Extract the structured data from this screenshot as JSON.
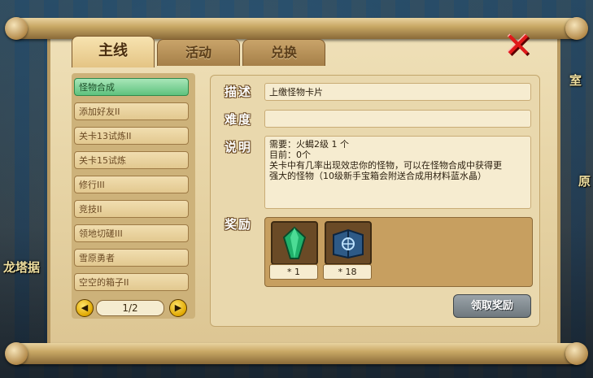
{
  "background": {
    "label_left": "龙塔据",
    "label_right_top": "室",
    "label_right_mid": "原"
  },
  "tabs": [
    {
      "label": "主线",
      "active": true
    },
    {
      "label": "活动",
      "active": false
    },
    {
      "label": "兑换",
      "active": false
    }
  ],
  "close_symbol": "✕",
  "quest_list": {
    "items": [
      {
        "label": "怪物合成",
        "active": true
      },
      {
        "label": "添加好友II",
        "active": false
      },
      {
        "label": "关卡13试炼II",
        "active": false
      },
      {
        "label": "关卡15试炼",
        "active": false
      },
      {
        "label": "修行III",
        "active": false
      },
      {
        "label": "竞技II",
        "active": false
      },
      {
        "label": "领地切磋III",
        "active": false
      },
      {
        "label": "雪原勇者",
        "active": false
      },
      {
        "label": "空空的箱子II",
        "active": false
      }
    ],
    "page_indicator": "1/2",
    "prev_arrow": "◀",
    "next_arrow": "▶"
  },
  "detail": {
    "desc_label": "描述",
    "desc_value": "上缴怪物卡片",
    "difficulty_label": "难度",
    "difficulty_value": "",
    "explain_label": "说明",
    "explain_lines": [
      "需要：火蝎2级   1 个",
      "目前：0个",
      "关卡中有几率出现效忠你的怪物，可以在怪物合成中获得更",
      "强大的怪物（10级新手宝箱会附送合成用材料蓝水晶）"
    ],
    "reward_label": "奖励",
    "rewards": [
      {
        "icon": "green-crystal-icon",
        "count": "* 1"
      },
      {
        "icon": "blue-book-icon",
        "count": "* 18"
      }
    ],
    "claim_button": "领取奖励"
  },
  "colors": {
    "active_item": "#5fc27e",
    "close_red": "#e01a1a",
    "parchment": "#e6d3a4"
  }
}
